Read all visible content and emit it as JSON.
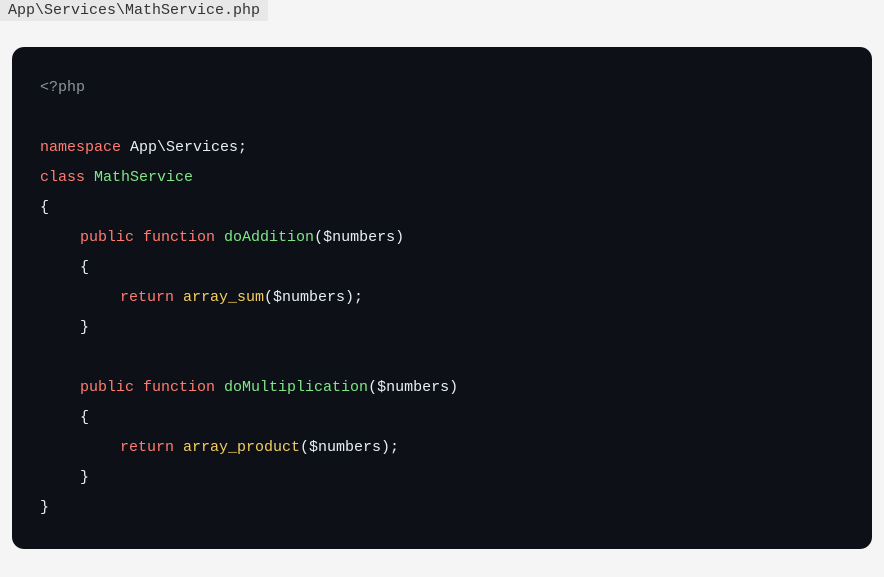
{
  "file_path": "App\\Services\\MathService.php",
  "code": {
    "open_tag": "<?php",
    "namespace_kw": "namespace",
    "namespace_val": " App\\Services;",
    "class_kw": "class",
    "class_name": " MathService",
    "brace_open": "{",
    "brace_close": "}",
    "public_kw": "public",
    "function_kw": " function",
    "method1_name": " doAddition",
    "method1_params": "($numbers)",
    "return_kw": "return",
    "method1_call": " array_sum",
    "method1_args": "($numbers);",
    "method2_name": " doMultiplication",
    "method2_params": "($numbers)",
    "method2_call": " array_product",
    "method2_args": "($numbers);"
  }
}
